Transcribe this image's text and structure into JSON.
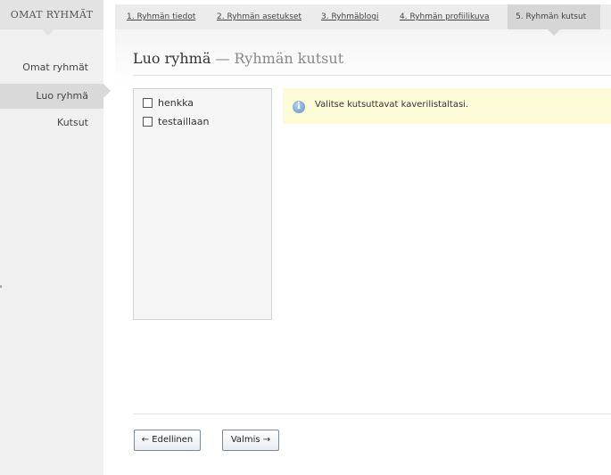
{
  "sidebar": {
    "header": "OMAT RYHMÄT",
    "items": [
      {
        "label": "Omat ryhmät",
        "active": false
      },
      {
        "label": "Luo ryhmä",
        "active": true
      },
      {
        "label": "Kutsut",
        "active": false
      }
    ]
  },
  "tabs": [
    {
      "label": "1. Ryhmän tiedot",
      "active": false
    },
    {
      "label": "2. Ryhmän asetukset",
      "active": false
    },
    {
      "label": "3. Ryhmäblogi",
      "active": false
    },
    {
      "label": "4. Ryhmän profiilikuva",
      "active": false
    },
    {
      "label": "5. Ryhmän kutsut",
      "active": true
    }
  ],
  "page": {
    "title": "Luo ryhmä",
    "separator": " — ",
    "subtitle": "Ryhmän kutsut"
  },
  "friends": [
    {
      "name": "henkka",
      "checked": false
    },
    {
      "name": "testaillaan",
      "checked": false
    }
  ],
  "info": {
    "icon": "info-icon",
    "text": "Valitse kutsuttavat kaverilistaltasi."
  },
  "buttons": {
    "previous": "← Edellinen",
    "done": "Valmis →"
  },
  "colors": {
    "info_background": "#fdfbd8",
    "active_tab": "#d6d6d6",
    "sidebar_active": "#d9d9d9"
  }
}
